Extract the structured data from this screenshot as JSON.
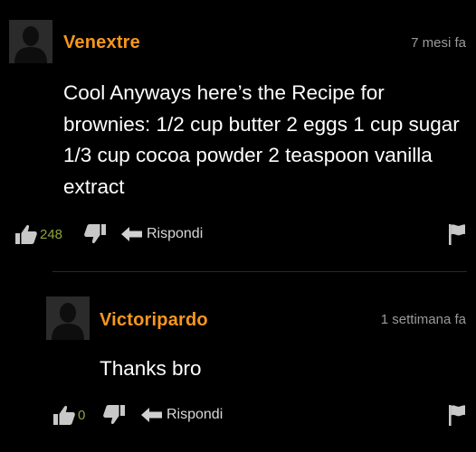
{
  "comments": [
    {
      "username": "Venextre",
      "timestamp": "7 mesi fa",
      "text": "Cool Anyways here’s the Recipe for brownies: 1/2 cup butter 2 eggs 1 cup sugar 1/3 cup cocoa powder 2 teaspoon vanilla extract",
      "likes": "248",
      "reply_label": "Rispondi"
    },
    {
      "username": "Victoripardo",
      "timestamp": "1 settimana fa",
      "text": "Thanks bro",
      "likes": "0",
      "reply_label": "Rispondi"
    }
  ],
  "icons": {
    "like": "thumbs-up-icon",
    "dislike": "thumbs-down-icon",
    "reply": "reply-arrow-icon",
    "flag": "flag-icon",
    "avatar": "default-avatar"
  },
  "colors": {
    "background": "#000000",
    "username": "#f7971d",
    "like_count": "#8ea33b",
    "text": "#ffffff",
    "muted": "#9a9a9a"
  }
}
